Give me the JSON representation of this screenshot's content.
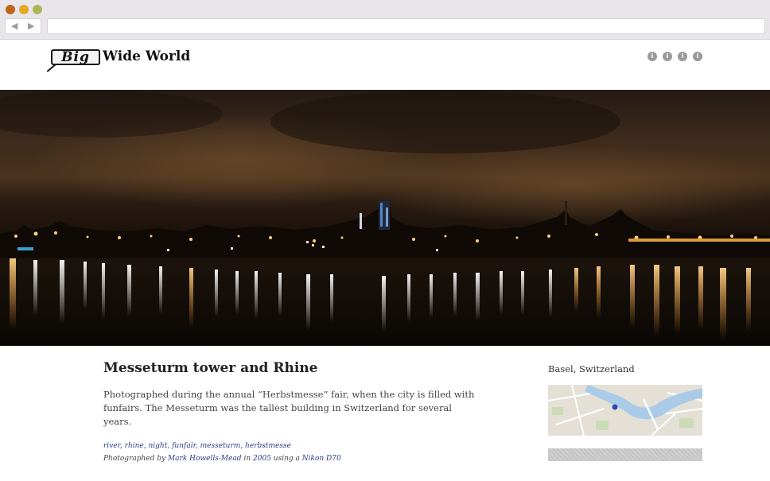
{
  "browser": {
    "back_icon": "◀",
    "forward_icon": "▶",
    "url": ""
  },
  "header": {
    "logo_box_text": "Big",
    "logo_text": "Wide World",
    "info_icons": [
      "i",
      "i",
      "i",
      "i"
    ]
  },
  "photo": {
    "title": "Messeturm tower and Rhine",
    "description": "Photographed during the annual “Herbstmesse” fair, when the city is filled with funfairs. The Messeturm was the tallest building in Switzerland for several years.",
    "tags": [
      "river",
      "rhine",
      "night",
      "funfair",
      "messeturm",
      "herbstmesse"
    ],
    "credit": {
      "prefix": "Photographed by",
      "photographer": "Mark Howells-Mead",
      "in": "in",
      "year": "2005",
      "using": "using a",
      "camera": "Nikon D70"
    }
  },
  "sidebar": {
    "location": "Basel, Switzerland"
  },
  "colors": {
    "link": "#2a3a8c",
    "sky_top": "#2a1e16",
    "sky_glow": "#5e3f22",
    "water": "#120c08"
  }
}
